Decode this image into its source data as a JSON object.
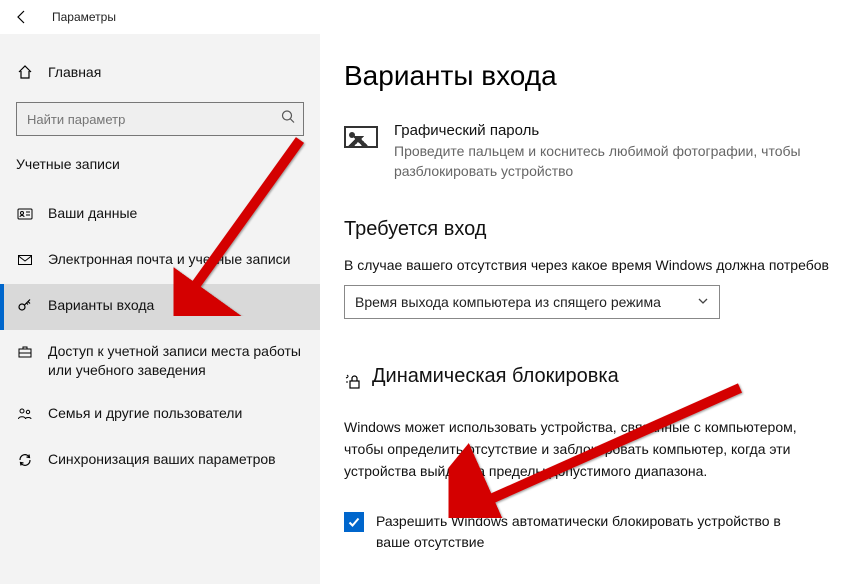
{
  "window": {
    "app_title": "Параметры"
  },
  "sidebar": {
    "home_label": "Главная",
    "search_placeholder": "Найти параметр",
    "section_title": "Учетные записи",
    "items": [
      {
        "label": "Ваши данные"
      },
      {
        "label": "Электронная почта и учетные записи"
      },
      {
        "label": "Варианты входа"
      },
      {
        "label": "Доступ к учетной записи места работы или учебного заведения"
      },
      {
        "label": "Семья и другие пользователи"
      },
      {
        "label": "Синхронизация ваших параметров"
      }
    ]
  },
  "main": {
    "page_title": "Варианты входа",
    "picture_password": {
      "title": "Графический пароль",
      "desc": "Проведите пальцем и коснитесь любимой фотографии, чтобы разблокировать устройство"
    },
    "require_signin": {
      "heading": "Требуется вход",
      "desc": "В случае вашего отсутствия через какое время Windows должна потребов",
      "select_value": "Время выхода компьютера из спящего режима"
    },
    "dynamic_lock": {
      "heading": "Динамическая блокировка",
      "desc": "Windows может использовать устройства, связанные с компьютером, чтобы определить отсутствие и заблокировать компьютер, когда эти устройства выйдут за пределы допустимого диапазона.",
      "checkbox_label": "Разрешить Windows автоматически блокировать устройство в ваше отсутствие",
      "checked": true
    }
  }
}
